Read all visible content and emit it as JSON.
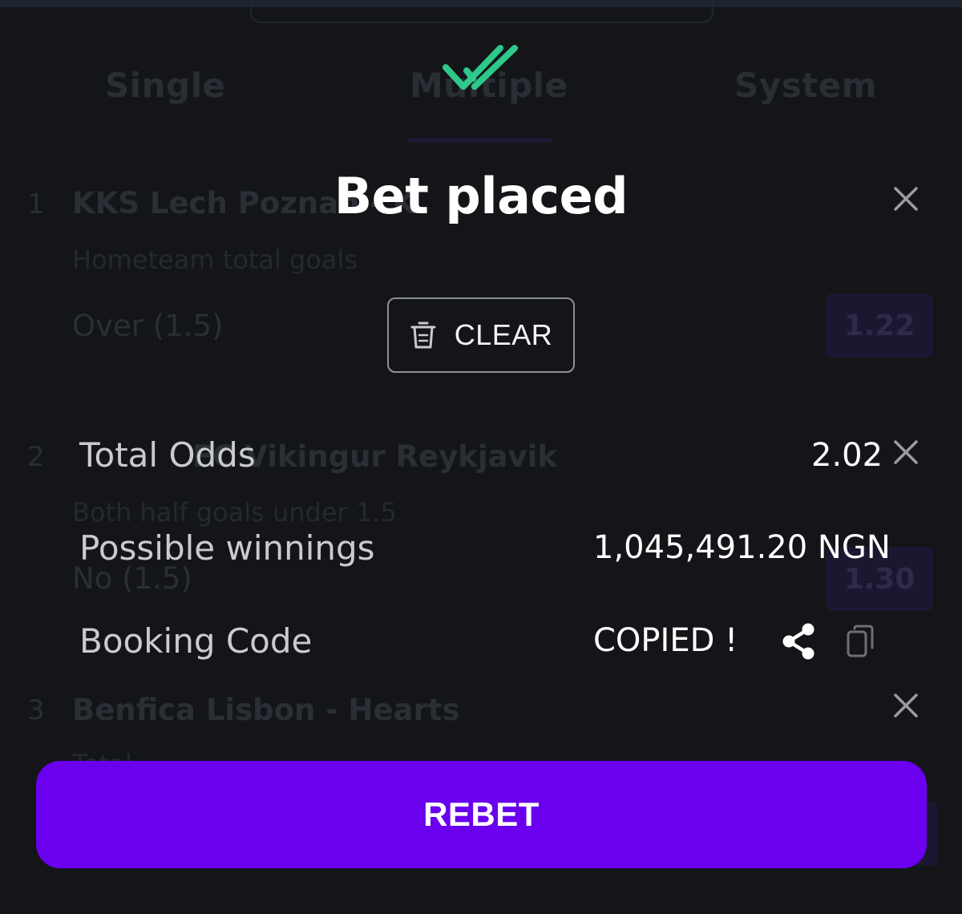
{
  "colors": {
    "background": "#131518",
    "accent_purple": "#6a00ee",
    "success_green": "#2ec98a",
    "text_primary": "#ffffff",
    "text_secondary": "#c9cbd0"
  },
  "betslip_background": {
    "tabs": [
      {
        "label": "Single"
      },
      {
        "label": "Multiple"
      },
      {
        "label": "System"
      }
    ],
    "selections": [
      {
        "number": "1",
        "match": "KKS Lech Poznan - K",
        "market": "Hometeam total goals",
        "selection": "Over (1.5)",
        "odds": "1.22"
      },
      {
        "number": "2",
        "match": "FC Vikingur Reykjavik",
        "market": "Both half goals under 1.5",
        "selection": "No (1.5)",
        "odds": "1.30"
      },
      {
        "number": "3",
        "match": "Benfica Lisbon - Hearts",
        "market": "Total",
        "selection": "",
        "odds": ""
      }
    ]
  },
  "modal": {
    "icon": "double-check-icon",
    "title": "Bet placed",
    "clear_button": {
      "label": "CLEAR",
      "icon": "trash-icon"
    },
    "rows": {
      "total_odds": {
        "label": "Total Odds",
        "value": "2.02"
      },
      "possible_winnings": {
        "label": "Possible winnings",
        "value": "1,045,491.20 NGN"
      },
      "booking_code": {
        "label": "Booking Code",
        "value": "COPIED !",
        "share_icon": "share-icon",
        "copy_icon": "copy-icon"
      }
    },
    "rebet_button": {
      "label": "REBET"
    }
  }
}
